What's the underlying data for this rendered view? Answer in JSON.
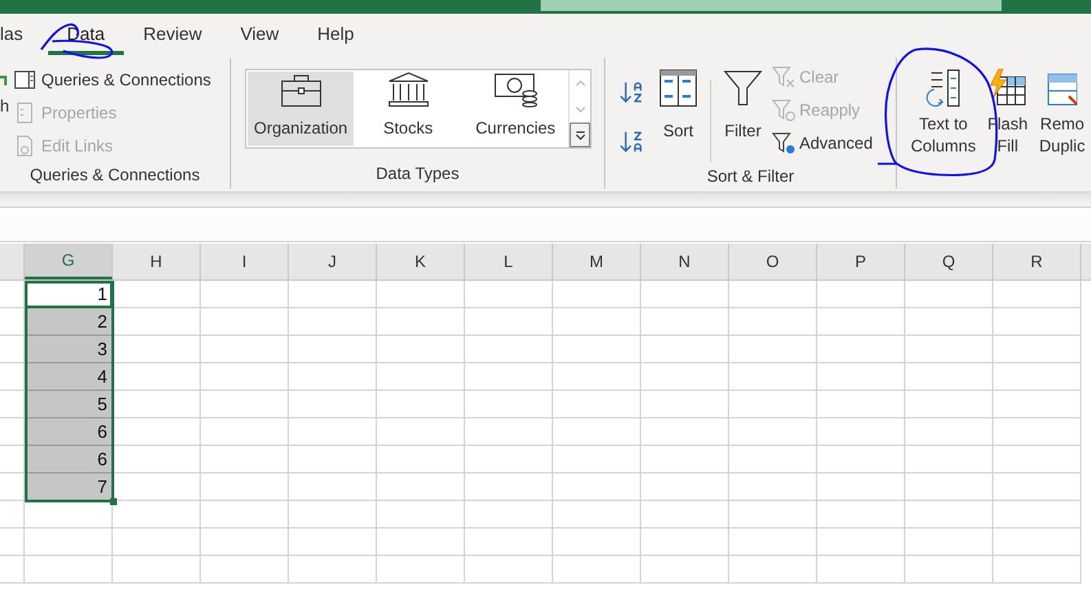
{
  "tabs": [
    {
      "label": "las",
      "selected": false
    },
    {
      "label": "Data",
      "selected": true
    },
    {
      "label": "Review",
      "selected": false
    },
    {
      "label": "View",
      "selected": false
    },
    {
      "label": "Help",
      "selected": false
    }
  ],
  "ribbon": {
    "groups": [
      {
        "kind": "list",
        "label": "Queries & Connections",
        "cut_label": "h",
        "items": [
          {
            "label": "Queries & Connections",
            "disabled": false
          },
          {
            "label": "Properties",
            "disabled": true
          },
          {
            "label": "Edit Links",
            "disabled": true
          }
        ]
      },
      {
        "kind": "gallery",
        "label": "Data Types",
        "items": [
          {
            "label": "Organization",
            "selected": true
          },
          {
            "label": "Stocks",
            "selected": false
          },
          {
            "label": "Currencies",
            "selected": false
          }
        ]
      },
      {
        "kind": "sort_filter",
        "label": "Sort & Filter",
        "sort": "Sort",
        "filter": "Filter",
        "items": [
          {
            "label": "Clear",
            "disabled": true
          },
          {
            "label": "Reapply",
            "disabled": true
          },
          {
            "label": "Advanced",
            "disabled": false
          }
        ]
      },
      {
        "kind": "tools",
        "items": [
          {
            "lines": [
              "Text to",
              "Columns"
            ]
          },
          {
            "lines": [
              "Flash",
              "Fill"
            ]
          },
          {
            "lines": [
              "Remo",
              "Duplic"
            ]
          }
        ]
      }
    ]
  },
  "grid": {
    "columns": [
      {
        "label": "G",
        "selected": true
      },
      {
        "label": "H",
        "selected": false
      },
      {
        "label": "I",
        "selected": false
      },
      {
        "label": "J",
        "selected": false
      },
      {
        "label": "K",
        "selected": false
      },
      {
        "label": "L",
        "selected": false
      },
      {
        "label": "M",
        "selected": false
      },
      {
        "label": "N",
        "selected": false
      },
      {
        "label": "O",
        "selected": false
      },
      {
        "label": "P",
        "selected": false
      },
      {
        "label": "Q",
        "selected": false
      },
      {
        "label": "R",
        "selected": false
      }
    ],
    "cells": [
      {
        "value": "1",
        "selected": true,
        "active": true
      },
      {
        "value": "2",
        "selected": true,
        "active": false
      },
      {
        "value": "3",
        "selected": true,
        "active": false
      },
      {
        "value": "4",
        "selected": true,
        "active": false
      },
      {
        "value": "5",
        "selected": true,
        "active": false
      },
      {
        "value": "6",
        "selected": true,
        "active": false
      },
      {
        "value": "6",
        "selected": true,
        "active": false
      },
      {
        "value": "7",
        "selected": true,
        "active": false
      }
    ]
  }
}
